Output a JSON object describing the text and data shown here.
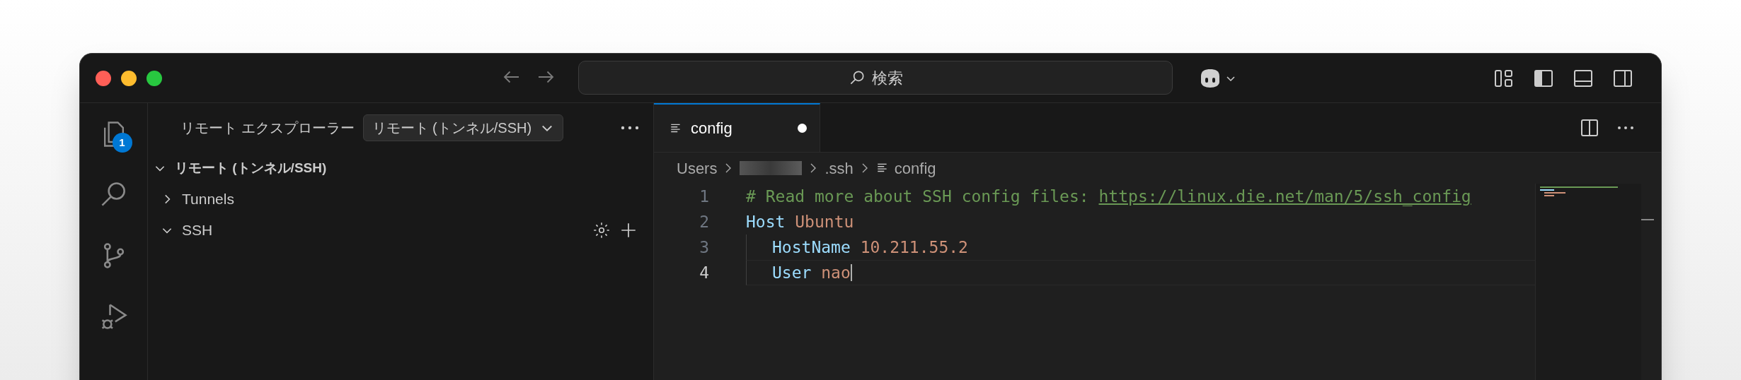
{
  "title_bar": {
    "search": {
      "placeholder": "検索"
    }
  },
  "activity_bar": [
    {
      "kind": "explorer",
      "badge": "1",
      "selected": false
    },
    {
      "kind": "search",
      "selected": false
    },
    {
      "kind": "source-control",
      "selected": false
    },
    {
      "kind": "run-debug",
      "selected": false
    }
  ],
  "sidebar": {
    "title": "リモート エクスプローラー",
    "dropdown": "リモート (トンネル/SSH)",
    "tree": [
      {
        "label": "リモート (トンネル/SSH)",
        "expanded": true,
        "children": [
          {
            "label": "Tunnels",
            "expanded": false,
            "actions": false
          },
          {
            "label": "SSH",
            "expanded": true,
            "actions": true
          }
        ]
      }
    ]
  },
  "tabs": [
    {
      "label": "config",
      "selected": true,
      "modified": true
    }
  ],
  "breadcrumb": [
    {
      "kind": "text",
      "label": "Users"
    },
    {
      "kind": "redacted"
    },
    {
      "kind": "text",
      "label": ".ssh"
    },
    {
      "kind": "file",
      "label": "config"
    }
  ],
  "editor": {
    "lines": [
      {
        "number": "1",
        "current": false,
        "indented": false,
        "tokens": [
          {
            "kind": "comment",
            "text": "# Read more about SSH config files: "
          },
          {
            "kind": "link",
            "text": "https://linux.die.net/man/5/ssh_config"
          }
        ]
      },
      {
        "number": "2",
        "current": false,
        "indented": false,
        "tokens": [
          {
            "kind": "keyword",
            "text": "Host"
          },
          {
            "kind": "value",
            "text": " Ubuntu"
          }
        ]
      },
      {
        "number": "3",
        "current": false,
        "indented": true,
        "tokens": [
          {
            "kind": "keyword",
            "text": "HostName"
          },
          {
            "kind": "value",
            "text": " 10.211.55.2"
          }
        ]
      },
      {
        "number": "4",
        "current": true,
        "indented": true,
        "tokens": [
          {
            "kind": "keyword",
            "text": "User"
          },
          {
            "kind": "value",
            "text": " nao"
          }
        ]
      }
    ]
  }
}
